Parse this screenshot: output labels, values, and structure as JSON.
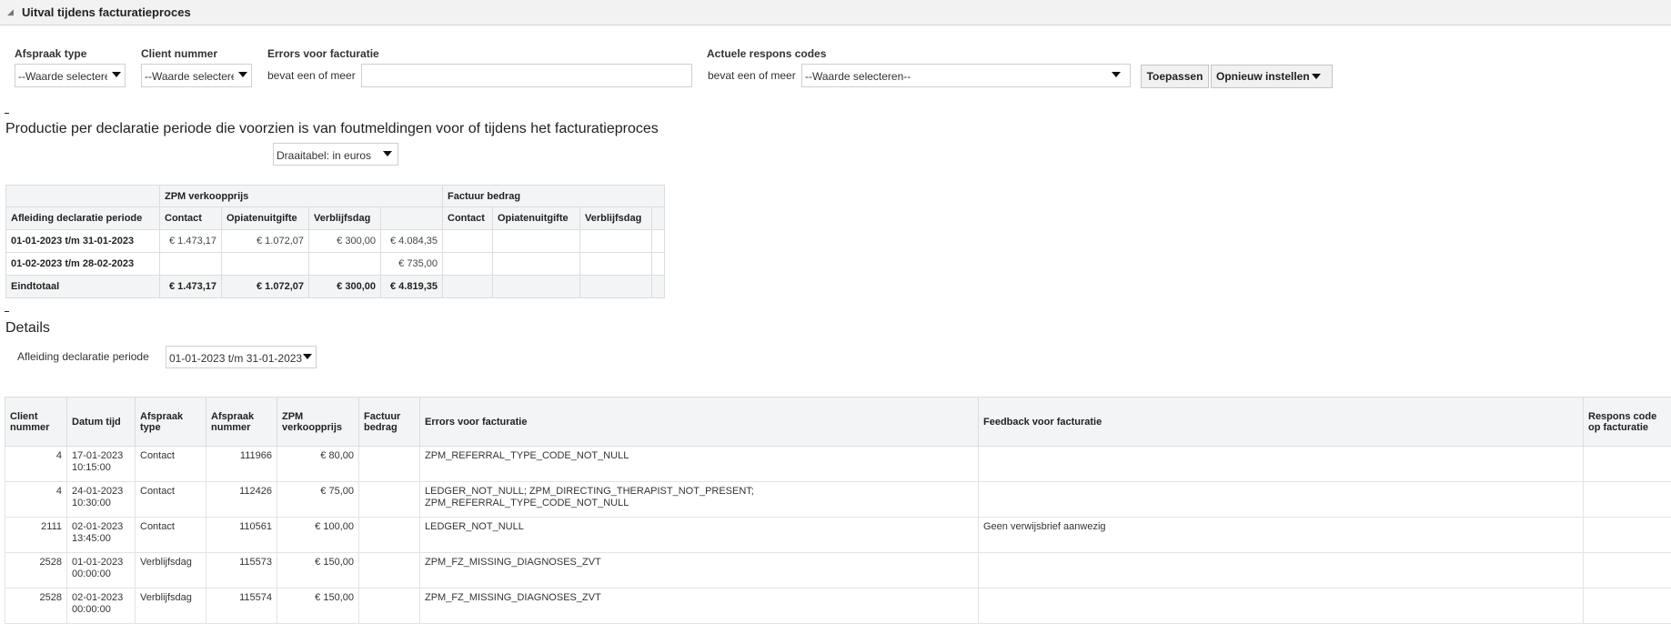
{
  "section": {
    "title": "Uitval tijdens facturatieproces"
  },
  "filters": {
    "afspraak_type": {
      "label": "Afspraak type",
      "value": "--Waarde selecteren--"
    },
    "client_nummer": {
      "label": "Client nummer",
      "value": "--Waarde selecteren--"
    },
    "errors": {
      "label": "Errors voor facturatie",
      "operator": "bevat een of meer",
      "value": ""
    },
    "respons": {
      "label": "Actuele respons codes",
      "operator": "bevat een of meer",
      "value": "--Waarde selecteren--"
    },
    "apply_label": "Toepassen",
    "reset_label": "Opnieuw instellen"
  },
  "pivot_section": {
    "title": "Productie per declaratie periode die voorzien is van foutmeldingen voor of tijdens het facturatieproces",
    "view_select": "Draaitabel: in euros",
    "groups": [
      "ZPM verkoopprijs",
      "Factuur bedrag"
    ],
    "row_header": "Afleiding declaratie periode",
    "columns": [
      "Contact",
      "Opiatenuitgifte",
      "Verblijfsdag"
    ],
    "rows": [
      {
        "label": "01-01-2023 t/m 31-01-2023",
        "zpm": [
          "€ 1.473,17",
          "€ 1.072,07",
          "€ 300,00",
          "€ 4.084,35"
        ],
        "factuur": [
          "",
          "",
          "",
          ""
        ]
      },
      {
        "label": "01-02-2023 t/m 28-02-2023",
        "zpm": [
          "",
          "",
          "",
          "€ 735,00"
        ],
        "factuur": [
          "",
          "",
          "",
          ""
        ]
      }
    ],
    "total": {
      "label": "Eindtotaal",
      "zpm": [
        "€ 1.473,17",
        "€ 1.072,07",
        "€ 300,00",
        "€ 4.819,35"
      ],
      "factuur": [
        "",
        "",
        "",
        ""
      ]
    }
  },
  "details": {
    "title": "Details",
    "prompt_label": "Afleiding declaratie periode",
    "prompt_value": "01-01-2023 t/m 31-01-2023",
    "headers": [
      "Client nummer",
      "Datum tijd",
      "Afspraak type",
      "Afspraak nummer",
      "ZPM verkoopprijs",
      "Factuur bedrag",
      "Errors voor facturatie",
      "Feedback voor facturatie",
      "Respons code op facturatie"
    ],
    "rows": [
      {
        "client": "4",
        "date": "17-01-2023",
        "time": "10:15:00",
        "type": "Contact",
        "number": "111966",
        "zpm": "€ 80,00",
        "factuur": "",
        "errors1": "ZPM_REFERRAL_TYPE_CODE_NOT_NULL",
        "errors2": "",
        "feedback": "",
        "respons": ""
      },
      {
        "client": "4",
        "date": "24-01-2023",
        "time": "10:30:00",
        "type": "Contact",
        "number": "112426",
        "zpm": "€ 75,00",
        "factuur": "",
        "errors1": "LEDGER_NOT_NULL; ZPM_DIRECTING_THERAPIST_NOT_PRESENT;",
        "errors2": "ZPM_REFERRAL_TYPE_CODE_NOT_NULL",
        "feedback": "",
        "respons": ""
      },
      {
        "client": "2111",
        "date": "02-01-2023",
        "time": "13:45:00",
        "type": "Contact",
        "number": "110561",
        "zpm": "€ 100,00",
        "factuur": "",
        "errors1": "LEDGER_NOT_NULL",
        "errors2": "",
        "feedback": "Geen verwijsbrief aanwezig",
        "respons": ""
      },
      {
        "client": "2528",
        "date": "01-01-2023",
        "time": "00:00:00",
        "type": "Verblijfsdag",
        "number": "115573",
        "zpm": "€ 150,00",
        "factuur": "",
        "errors1": "ZPM_FZ_MISSING_DIAGNOSES_ZVT",
        "errors2": "",
        "feedback": "",
        "respons": ""
      },
      {
        "client": "2528",
        "date": "02-01-2023",
        "time": "00:00:00",
        "type": "Verblijfsdag",
        "number": "115574",
        "zpm": "€ 150,00",
        "factuur": "",
        "errors1": "ZPM_FZ_MISSING_DIAGNOSES_ZVT",
        "errors2": "",
        "feedback": "",
        "respons": ""
      }
    ]
  }
}
